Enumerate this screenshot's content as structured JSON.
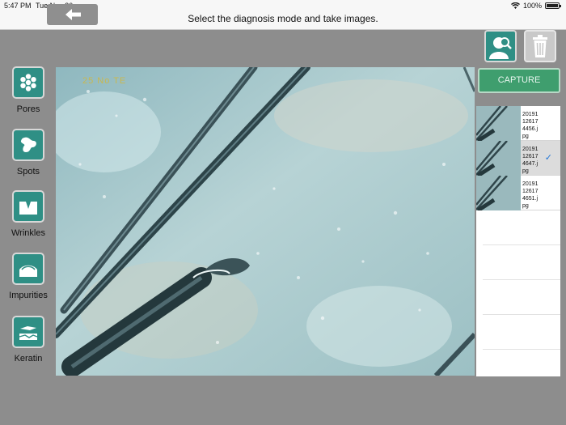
{
  "status_bar": {
    "time": "5:47 PM",
    "date": "Tue Nov 26",
    "battery": "100%",
    "battery_level": 1.0
  },
  "header": {
    "title": "Select the diagnosis mode and take images.",
    "back_icon": "arrow-left-icon"
  },
  "modes": [
    {
      "label": "Pores",
      "icon": "pores-icon"
    },
    {
      "label": "Spots",
      "icon": "spots-icon"
    },
    {
      "label": "Wrinkles",
      "icon": "wrinkles-icon"
    },
    {
      "label": "Impurities",
      "icon": "impurities-icon"
    },
    {
      "label": "Keratin",
      "icon": "keratin-icon"
    }
  ],
  "viewer": {
    "overlay_text": "25 No TE"
  },
  "actions": {
    "capture_label": "CAPTURE",
    "user_icon": "user-search-icon",
    "trash_icon": "trash-icon"
  },
  "thumbnails": [
    {
      "name": "2019112617 4456.jpg",
      "lines": [
        "20191",
        "12617",
        "4456.j",
        "pg"
      ],
      "selected": false
    },
    {
      "name": "2019112617 4647.jpg",
      "lines": [
        "20191",
        "12617",
        "4647.j",
        "pg"
      ],
      "selected": true
    },
    {
      "name": "2019112617 4651.jpg",
      "lines": [
        "20191",
        "12617",
        "4651.j",
        "pg"
      ],
      "selected": false
    }
  ],
  "colors": {
    "accent_teal": "#2f8f85",
    "capture_green": "#3f9e6e",
    "check_blue": "#1e74d8",
    "background_gray": "#8d8d8d"
  }
}
